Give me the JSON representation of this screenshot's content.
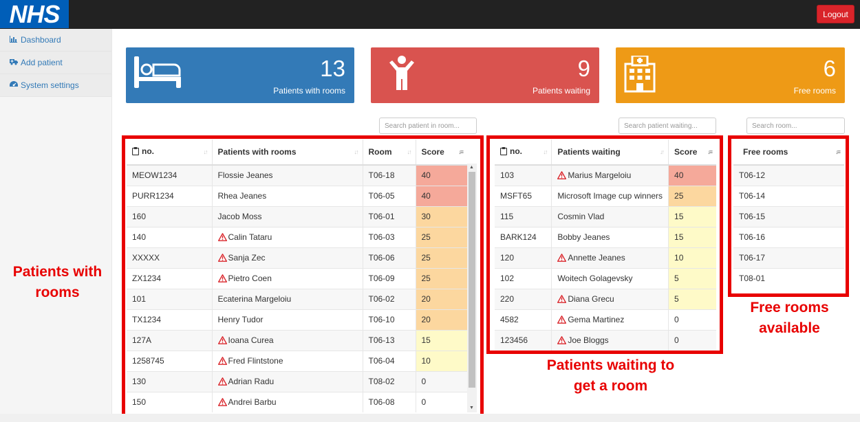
{
  "app": {
    "logo": "NHS",
    "logout_label": "Logout"
  },
  "sidebar": {
    "items": [
      {
        "label": "Dashboard",
        "icon": "bar-chart-icon"
      },
      {
        "label": "Add patient",
        "icon": "ambulance-icon"
      },
      {
        "label": "System settings",
        "icon": "dashboard-gauge-icon"
      }
    ]
  },
  "cards": {
    "rooms": {
      "count": "13",
      "label": "Patients with rooms",
      "icon": "bed-icon",
      "color": "#337ab7"
    },
    "waiting": {
      "count": "9",
      "label": "Patients waiting",
      "icon": "person-icon",
      "color": "#d9534f"
    },
    "free": {
      "count": "6",
      "label": "Free rooms",
      "icon": "hospital-icon",
      "color": "#ee9a16"
    }
  },
  "search": {
    "rooms_placeholder": "Search patient in room...",
    "waiting_placeholder": "Search patient waiting...",
    "free_placeholder": "Search room..."
  },
  "rooms_table": {
    "headers": {
      "no": "no.",
      "name": "Patients with rooms",
      "room": "Room",
      "score": "Score"
    },
    "rows": [
      {
        "no": "MEOW1234",
        "name": "Flossie Jeanes",
        "room": "T06-18",
        "score": "40",
        "warn": false
      },
      {
        "no": "PURR1234",
        "name": "Rhea Jeanes",
        "room": "T06-05",
        "score": "40",
        "warn": false
      },
      {
        "no": "160",
        "name": "Jacob Moss",
        "room": "T06-01",
        "score": "30",
        "warn": false
      },
      {
        "no": "140",
        "name": "Calin Tataru",
        "room": "T06-03",
        "score": "25",
        "warn": true
      },
      {
        "no": "XXXXX",
        "name": "Sanja Zec",
        "room": "T06-06",
        "score": "25",
        "warn": true
      },
      {
        "no": "ZX1234",
        "name": "Pietro Coen",
        "room": "T06-09",
        "score": "25",
        "warn": true
      },
      {
        "no": "101",
        "name": "Ecaterina Margeloiu",
        "room": "T06-02",
        "score": "20",
        "warn": false
      },
      {
        "no": "TX1234",
        "name": "Henry Tudor",
        "room": "T06-10",
        "score": "20",
        "warn": false
      },
      {
        "no": "127A",
        "name": "Ioana Curea",
        "room": "T06-13",
        "score": "15",
        "warn": true
      },
      {
        "no": "1258745",
        "name": "Fred Flintstone",
        "room": "T06-04",
        "score": "10",
        "warn": true
      },
      {
        "no": "130",
        "name": "Adrian Radu",
        "room": "T08-02",
        "score": "0",
        "warn": true
      },
      {
        "no": "150",
        "name": "Andrei Barbu",
        "room": "T06-08",
        "score": "0",
        "warn": true
      }
    ]
  },
  "waiting_table": {
    "headers": {
      "no": "no.",
      "name": "Patients waiting",
      "score": "Score"
    },
    "rows": [
      {
        "no": "103",
        "name": "Marius Margeloiu",
        "score": "40",
        "warn": true
      },
      {
        "no": "MSFT65",
        "name": "Microsoft Image cup winners",
        "score": "25",
        "warn": false
      },
      {
        "no": "115",
        "name": "Cosmin Vlad",
        "score": "15",
        "warn": false
      },
      {
        "no": "BARK124",
        "name": "Bobby Jeanes",
        "score": "15",
        "warn": false
      },
      {
        "no": "120",
        "name": "Annette Jeanes",
        "score": "10",
        "warn": true
      },
      {
        "no": "102",
        "name": "Woitech Golagevsky",
        "score": "5",
        "warn": false
      },
      {
        "no": "220",
        "name": "Diana Grecu",
        "score": "5",
        "warn": true
      },
      {
        "no": "4582",
        "name": "Gema Martinez",
        "score": "0",
        "warn": true
      },
      {
        "no": "123456",
        "name": "Joe Bloggs",
        "score": "0",
        "warn": true
      }
    ]
  },
  "free_table": {
    "header": "Free rooms",
    "rows": [
      "T06-12",
      "T06-14",
      "T06-15",
      "T06-16",
      "T06-17",
      "T08-01"
    ]
  },
  "annotations": {
    "rooms": "Patients with rooms",
    "waiting": "Patients waiting to get a room",
    "free": "Free rooms available"
  },
  "colors": {
    "score_high": "#f5a99a",
    "score_mid": "#fcd79f",
    "score_low": "#fefac8",
    "highlight_frame": "#e80000",
    "warning": "#d9242a"
  }
}
